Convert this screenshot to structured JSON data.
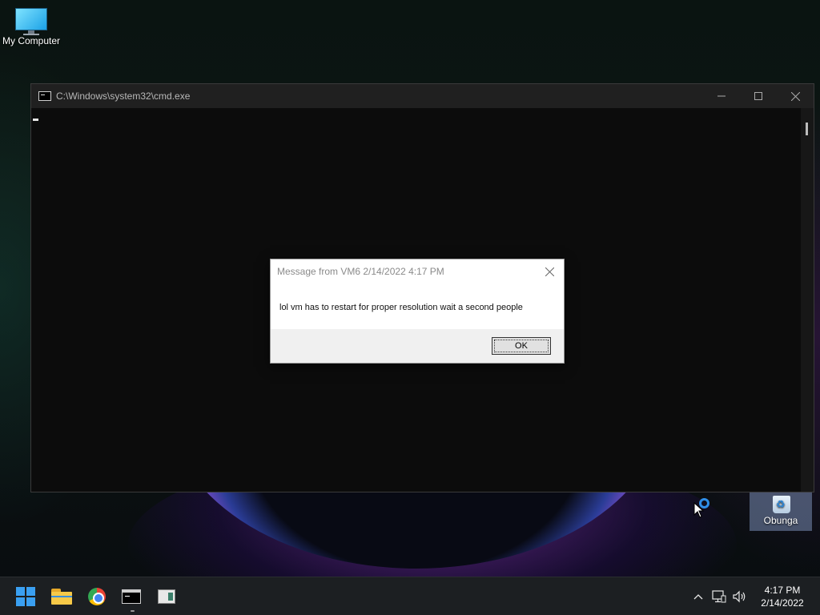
{
  "desktop": {
    "icons": [
      {
        "label": "My Computer",
        "icon": "monitor-icon"
      },
      {
        "label": "Obunga",
        "icon": "recycle-bin-icon"
      }
    ]
  },
  "cmd_window": {
    "title": "C:\\Windows\\system32\\cmd.exe",
    "icon": "cmd-icon",
    "controls": {
      "minimize": "—",
      "maximize": "☐",
      "close": "✕"
    }
  },
  "dialog": {
    "title": "Message from VM6 2/14/2022 4:17 PM",
    "message": "lol vm has to restart for proper resolution wait a second people",
    "ok_label": "OK",
    "close_glyph": "✕"
  },
  "taskbar": {
    "items": [
      {
        "name": "start",
        "icon": "windows-start-icon"
      },
      {
        "name": "file-explorer",
        "icon": "folder-icon"
      },
      {
        "name": "chrome",
        "icon": "chrome-icon"
      },
      {
        "name": "command-prompt",
        "icon": "terminal-icon",
        "running": true
      },
      {
        "name": "app",
        "icon": "app-window-icon"
      }
    ],
    "tray": {
      "chevron": "^",
      "network_icon": "network-icon",
      "volume_icon": "speaker-icon",
      "time": "4:17 PM",
      "date": "2/14/2022"
    }
  },
  "colors": {
    "taskbar_bg": "#1c1f22",
    "cmd_bg": "#0c0c0c",
    "cmd_titlebar": "#202020",
    "accent": "#3aa0f2"
  }
}
